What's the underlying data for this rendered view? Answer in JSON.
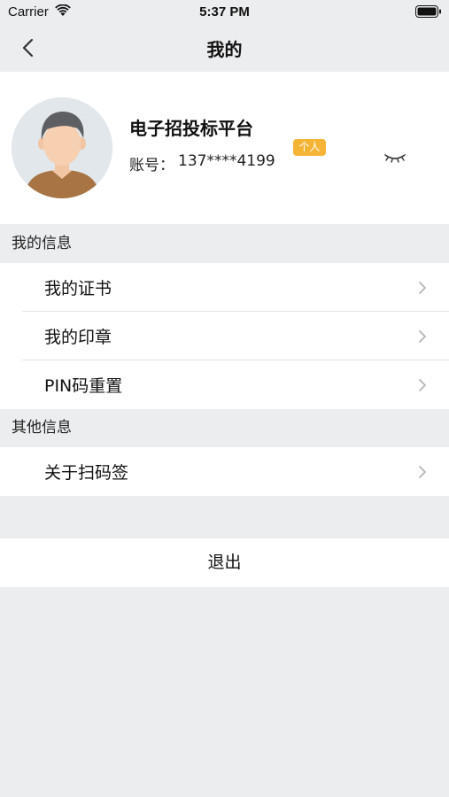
{
  "status_bar": {
    "carrier": "Carrier",
    "time": "5:37 PM"
  },
  "nav": {
    "title": "我的",
    "back_icon": "chevron-left-icon"
  },
  "profile": {
    "org_name": "电子招投标平台",
    "badge": "个人",
    "account_label": "账号：",
    "account_value": "137****4199",
    "badge_color": "#F6B437"
  },
  "sections": {
    "my_info": {
      "header": "我的信息",
      "items": [
        {
          "label": "我的证书"
        },
        {
          "label": "我的印章"
        },
        {
          "label": "PIN码重置"
        }
      ]
    },
    "other_info": {
      "header": "其他信息",
      "items": [
        {
          "label": "关于扫码签"
        }
      ]
    }
  },
  "logout_label": "退出",
  "colors": {
    "background": "#ECEDEF",
    "card": "#FFFFFF",
    "chevron": "#B5B5B5"
  }
}
